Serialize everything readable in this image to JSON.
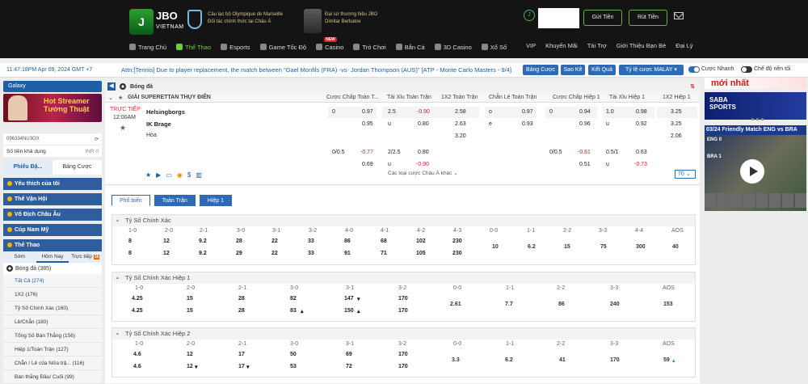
{
  "header": {
    "logo_text": "JBO",
    "logo_sub": "VIETNAM",
    "logo_badge": "J",
    "partner1_line1": "Câu lạc bộ Olympique de Marseille",
    "partner1_line2": "Đối tác chính thức tại Châu Á",
    "partner2_line1": "Đại sứ thương hiệu JBO",
    "partner2_line2": "Dimitar Berbatov",
    "deposit": "Gửi Tiền",
    "withdraw": "Rút Tiền"
  },
  "nav": [
    {
      "label": "Trang Chủ"
    },
    {
      "label": "Thể Thao"
    },
    {
      "label": "Esports"
    },
    {
      "label": "Game Tốc Độ"
    },
    {
      "label": "Casino",
      "tag": "NEW"
    },
    {
      "label": "Trò Chơi"
    },
    {
      "label": "Bắn Cá"
    },
    {
      "label": "3D Casino"
    },
    {
      "label": "Xổ Số"
    }
  ],
  "nav_right": [
    "VIP",
    "Khuyến Mãi",
    "Tài Trợ",
    "Giới Thiệu Bạn Bè",
    "Đại Lý"
  ],
  "bar": {
    "timestamp": "11:47:18PM Apr 09, 2024 GMT +7",
    "ticker": "Attn:[Tennis] Due to player replacement, the match between \"Gael Monfils (FRA) -vs- Jordan Thompson (AUS)\" [ATP - Monte Carlo Masters - 9/4].",
    "btn1": "Bảng Cược",
    "btn2": "Sao Kê",
    "btn3": "Kết Quả",
    "odds_type": "Tỷ lệ cược MALAY",
    "toggle1": "Cược Nhanh",
    "toggle2": "Chế độ nền tối"
  },
  "left": {
    "galaxy": "Galaxy",
    "banner_l1": "Hot Streamer",
    "banner_l2": "Tướng Thuật",
    "account": "096334NU3OX",
    "balance_label": "Số tiền khả dụng",
    "balance": "INR 0",
    "tab1": "Phiếu Đặ...",
    "tab2": "Bảng Cược",
    "fav": "Yêu thích của tôi",
    "olympic": "Thế Vận Hội",
    "euro": "Vô Địch Châu Âu",
    "copa": "Cúp Nam Mỹ",
    "sports": "Thể Thao",
    "sub_early": "Sớm",
    "sub_today": "Hôm Nay",
    "sub_live": "Trực tiếp",
    "live_badge": "16",
    "sport": "Bóng đá",
    "sport_count": "(385)",
    "markets": [
      {
        "l": "Tất Cả",
        "c": "(274)"
      },
      {
        "l": "1X2",
        "c": "(176)"
      },
      {
        "l": "Tỷ Số Chính Xác",
        "c": "(160)"
      },
      {
        "l": "Lẻ/Chẵn",
        "c": "(180)"
      },
      {
        "l": "Tổng Số Bàn Thắng",
        "c": "(156)"
      },
      {
        "l": "Hiệp 1/Toàn Trận",
        "c": "(127)"
      },
      {
        "l": "Chẵn / Lẻ của Nửa trậ...",
        "c": "(116)"
      },
      {
        "l": "Bàn thắng Đầu/ Cuối",
        "c": "(99)"
      }
    ]
  },
  "main": {
    "crumb": "Bóng đá",
    "league": "GIẢI SUPERETTAN THỤY ĐIỂN",
    "hdr": [
      "Cược Chấp Toàn T...",
      "Tài Xỉu Toàn Trận",
      "1X2 Toàn Trận",
      "Chẵn Lẻ Toàn Trận",
      "Cược Chấp Hiệp 1",
      "Tài Xỉu Hiệp 1",
      "1X2 Hiệp 1"
    ],
    "match": {
      "status": "TRỰC TIẾP",
      "time": "12:00AM",
      "home": "Helsingborgs",
      "away": "IK Brage",
      "draw": "Hòa",
      "r1": [
        "0",
        "0.97",
        "2.5",
        "-0.90",
        "2.58",
        "o",
        "0.97",
        "0",
        "0.94",
        "1.0",
        "0.98",
        "3.25"
      ],
      "r2": [
        "0.95",
        "u",
        "0.80",
        "2.63",
        "e",
        "0.93",
        "0.96",
        "u",
        "0.92",
        "3.25"
      ],
      "r3": [
        "3.20",
        "2.06"
      ],
      "r4": [
        "0/0.5",
        "-0.77",
        "2/2.5",
        "0.80",
        "0/0.5",
        "-0.61",
        "0.5/1",
        "0.63"
      ],
      "r5": [
        "0.69",
        "u",
        "-0.90",
        "0.51",
        "u",
        "-0.73"
      ],
      "asian": "Các loại cược Châu Á khác",
      "count": "70"
    },
    "tabs": [
      "Phổ biến",
      "Toàn Trận",
      "Hiệp 1"
    ],
    "sec1": {
      "title": "Tỷ Số Chính Xác",
      "labels": [
        "1-0",
        "2-0",
        "2-1",
        "3-0",
        "3-1",
        "3-2",
        "4-0",
        "4-1",
        "4-2",
        "4-3",
        "0-0",
        "1-1",
        "2-2",
        "3-3",
        "4-4",
        "AOS"
      ],
      "a": [
        "8",
        "12",
        "9.2",
        "28",
        "22",
        "33",
        "86",
        "68",
        "102",
        "230"
      ],
      "b": [
        "8",
        "12",
        "9.2",
        "29",
        "22",
        "33",
        "91",
        "71",
        "105",
        "230"
      ],
      "c": [
        "10",
        "6.2",
        "15",
        "75",
        "300",
        "40"
      ]
    },
    "sec2": {
      "title": "Tỷ Số Chính Xác Hiệp 1",
      "labels": [
        "1-0",
        "2-0",
        "2-1",
        "3-0",
        "3-1",
        "3-2",
        "0-0",
        "1-1",
        "2-2",
        "3-3",
        "AOS"
      ],
      "a": [
        "4.25",
        "15",
        "28",
        "82",
        "147",
        "170"
      ],
      "b": [
        "4.25",
        "15",
        "28",
        "83",
        "150",
        "170"
      ],
      "c": [
        "2.61",
        "7.7",
        "86",
        "240",
        "153"
      ]
    },
    "sec3": {
      "title": "Tỷ Số Chính Xác Hiệp 2",
      "labels": [
        "1-0",
        "2-0",
        "2-1",
        "3-0",
        "3-1",
        "3-2",
        "0-0",
        "1-1",
        "2-2",
        "3-3",
        "AOS"
      ],
      "a": [
        "4.6",
        "12",
        "17",
        "50",
        "69",
        "170"
      ],
      "b": [
        "4.6",
        "12",
        "17",
        "53",
        "72",
        "170"
      ],
      "c": [
        "3.3",
        "6.2",
        "41",
        "170",
        "59"
      ]
    }
  },
  "right": {
    "b1": "mới nhất",
    "b2_l1": "SABA",
    "b2_l2": "SPORTS",
    "b3": "03/24 Friendly Match ENG vs BRA",
    "eng": "ENG",
    "bra": "BRA",
    "score_h": "0",
    "score_a": "1"
  }
}
